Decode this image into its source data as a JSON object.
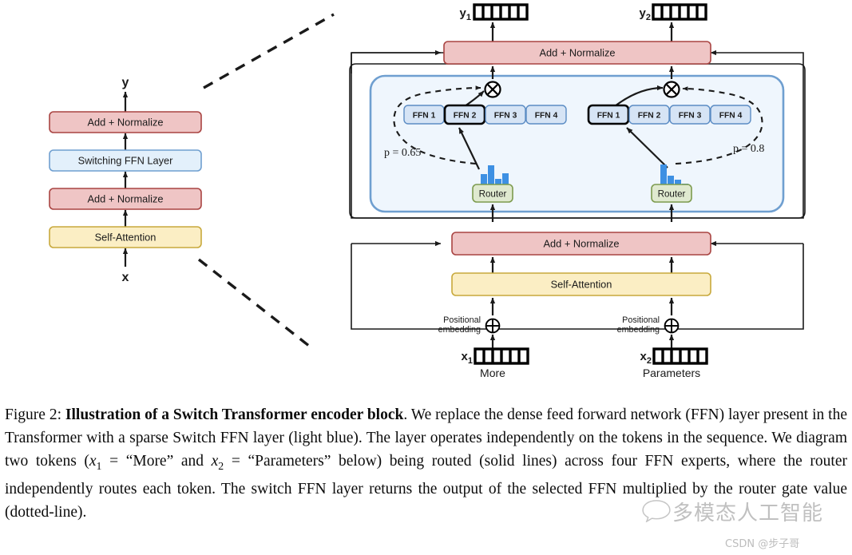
{
  "figure": {
    "left_diagram": {
      "output_label": "y",
      "input_label": "x",
      "blocks": [
        {
          "label": "Add + Normalize",
          "kind": "addnorm"
        },
        {
          "label": "Switching FFN Layer",
          "kind": "switchffn"
        },
        {
          "label": "Add + Normalize",
          "kind": "addnorm"
        },
        {
          "label": "Self-Attention",
          "kind": "attention"
        }
      ]
    },
    "right_diagram": {
      "top_addnorm_label": "Add + Normalize",
      "bottom_addnorm_label": "Add + Normalize",
      "self_attention_label": "Self-Attention",
      "positional_embedding_label_line1": "Positional",
      "positional_embedding_label_line2": "embedding",
      "columns": [
        {
          "output_token_label": "y",
          "output_token_sub": "1",
          "input_token_label": "x",
          "input_token_sub": "1",
          "word": "More",
          "router_label": "Router",
          "gate_label": "p = 0.65",
          "experts": [
            "FFN 1",
            "FFN 2",
            "FFN 3",
            "FFN 4"
          ],
          "selected_expert_index": 1,
          "router_histogram": [
            0.55,
            0.95,
            0.3,
            0.6
          ],
          "token_cells": 6
        },
        {
          "output_token_label": "y",
          "output_token_sub": "2",
          "input_token_label": "x",
          "input_token_sub": "2",
          "word": "Parameters",
          "router_label": "Router",
          "gate_label": "p = 0.8",
          "experts": [
            "FFN 1",
            "FFN 2",
            "FFN 3",
            "FFN 4"
          ],
          "selected_expert_index": 0,
          "router_histogram": [
            1.0,
            0.45,
            0.25,
            0.08
          ],
          "token_cells": 6
        }
      ]
    },
    "colors": {
      "addnorm_fill": "#efc5c5",
      "addnorm_stroke": "#a94442",
      "switchffn_fill": "#e3f0fb",
      "switchffn_stroke": "#6f9fd0",
      "attention_fill": "#fbeec4",
      "attention_stroke": "#c8a93c",
      "router_fill": "#dfe9cf",
      "router_stroke": "#7d9b4e",
      "expert_fill": "#d6e4f5",
      "expert_stroke": "#5b8cc4",
      "switch_panel_fill": "#eff6fd",
      "switch_panel_stroke": "#6f9fd0",
      "histogram_bar": "#3d90e3",
      "line": "#1a1a1a"
    }
  },
  "caption": {
    "figure_number": "Figure 2:",
    "title": "Illustration of a Switch Transformer encoder block",
    "body_1": ". We replace the dense feed forward network (FFN) layer present in the Transformer with a sparse Switch FFN layer (light blue). The layer operates independently on the tokens in the sequence. We diagram two tokens (",
    "math_x1": "x",
    "math_x1_sub": "1",
    "body_2": " = “More” and ",
    "math_x2": "x",
    "math_x2_sub": "2",
    "body_3": " = “Parameters” below) being routed (solid lines) across four FFN experts, where the router independently routes each token. The switch FFN layer returns the output of the selected FFN multiplied by the router gate value (dotted-line)."
  },
  "watermark": {
    "text": "多模态人工智能",
    "credit": "CSDN @步子哥"
  }
}
